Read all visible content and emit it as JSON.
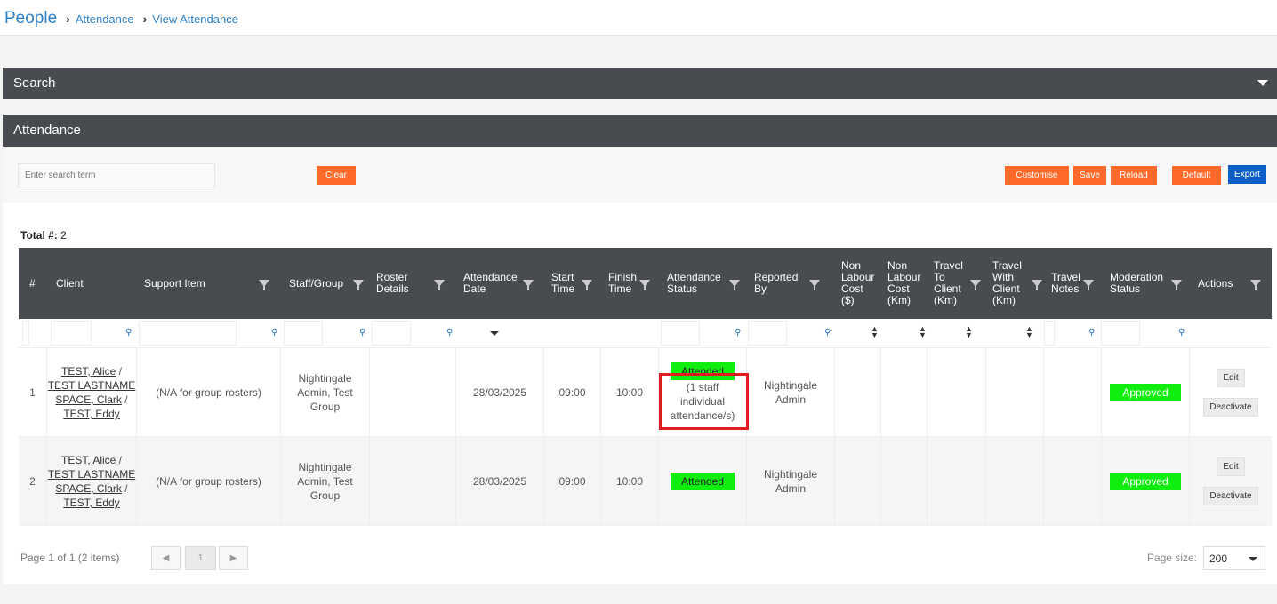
{
  "breadcrumb": {
    "root": "People",
    "items": [
      "Attendance",
      "View Attendance"
    ]
  },
  "search_bar": {
    "title": "Search"
  },
  "attendance_bar": {
    "title": "Attendance"
  },
  "toolbar": {
    "search_placeholder": "Enter search term",
    "clear_label": "Clear",
    "customise_label": "Customise",
    "save_label": "Save",
    "reload_label": "Reload",
    "default_label": "Default",
    "export_label": "Export"
  },
  "total": {
    "label": "Total #:",
    "value": "2"
  },
  "columns": [
    "#",
    "Client",
    "Support Item",
    "Staff/Group",
    "Roster Details",
    "Attendance Date",
    "Start Time",
    "Finish Time",
    "Attendance Status",
    "Reported By",
    "Non Labour Cost ($)",
    "Non Labour Cost (Km)",
    "Travel To Client (Km)",
    "Travel With Client (Km)",
    "Travel Notes",
    "Moderation Status",
    "Actions"
  ],
  "rows": [
    {
      "num": "1",
      "clients": [
        "TEST, Alice",
        "TEST LASTNAME SPACE, Clark",
        "TEST, Eddy"
      ],
      "support_item": "(N/A for group rosters)",
      "staff_group": "Nightingale Admin, Test Group",
      "attendance_date": "28/03/2025",
      "start_time": "09:00",
      "finish_time": "10:00",
      "attendance_status": "Attended",
      "status_note": "(1 staff individual attendance/s)",
      "reported_by": "Nightingale Admin",
      "moderation_status": "Approved",
      "edit_label": "Edit",
      "deactivate_label": "Deactivate"
    },
    {
      "num": "2",
      "clients": [
        "TEST, Alice",
        "TEST LASTNAME SPACE, Clark",
        "TEST, Eddy"
      ],
      "support_item": "(N/A for group rosters)",
      "staff_group": "Nightingale Admin, Test Group",
      "attendance_date": "28/03/2025",
      "start_time": "09:00",
      "finish_time": "10:00",
      "attendance_status": "Attended",
      "reported_by": "Nightingale Admin",
      "moderation_status": "Approved",
      "edit_label": "Edit",
      "deactivate_label": "Deactivate"
    }
  ],
  "pager": {
    "summary": "Page 1 of 1 (2 items)",
    "current_page": "1",
    "prev": "◀",
    "next": "▶",
    "size_label": "Page size:",
    "size_value": "200"
  },
  "colors": {
    "header_bg": "#484b4f",
    "accent_orange": "#ff6a2b",
    "accent_blue": "#0c5fc4",
    "status_green": "#10ee10",
    "highlight_red": "#e01b22"
  }
}
